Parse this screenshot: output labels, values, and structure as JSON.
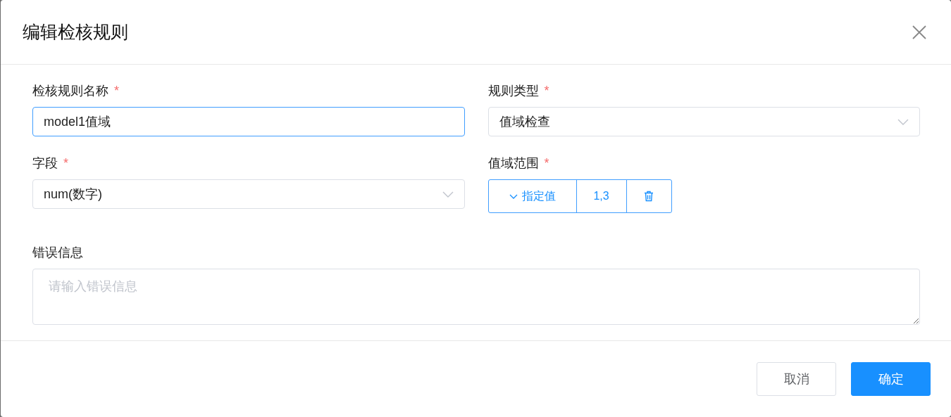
{
  "dialog": {
    "title": "编辑检核规则"
  },
  "fields": [
    {
      "kind": "text",
      "label": "检核规则名称",
      "required_mark": "*",
      "value": "model1值域",
      "focused": true
    },
    {
      "kind": "select",
      "label": "规则类型",
      "required_mark": "*",
      "value": "值域检查"
    },
    {
      "kind": "select",
      "label": "字段",
      "required_mark": "*",
      "value": "num(数字)"
    },
    {
      "kind": "range",
      "label": "值域范围",
      "required_mark": "*",
      "mode": "指定值",
      "value": "1,3"
    },
    {
      "kind": "textarea",
      "label": "错误信息",
      "placeholder": "请输入错误信息"
    }
  ],
  "buttons": [
    {
      "kind": "default",
      "label": "取消"
    },
    {
      "kind": "primary",
      "label": "确定"
    }
  ]
}
